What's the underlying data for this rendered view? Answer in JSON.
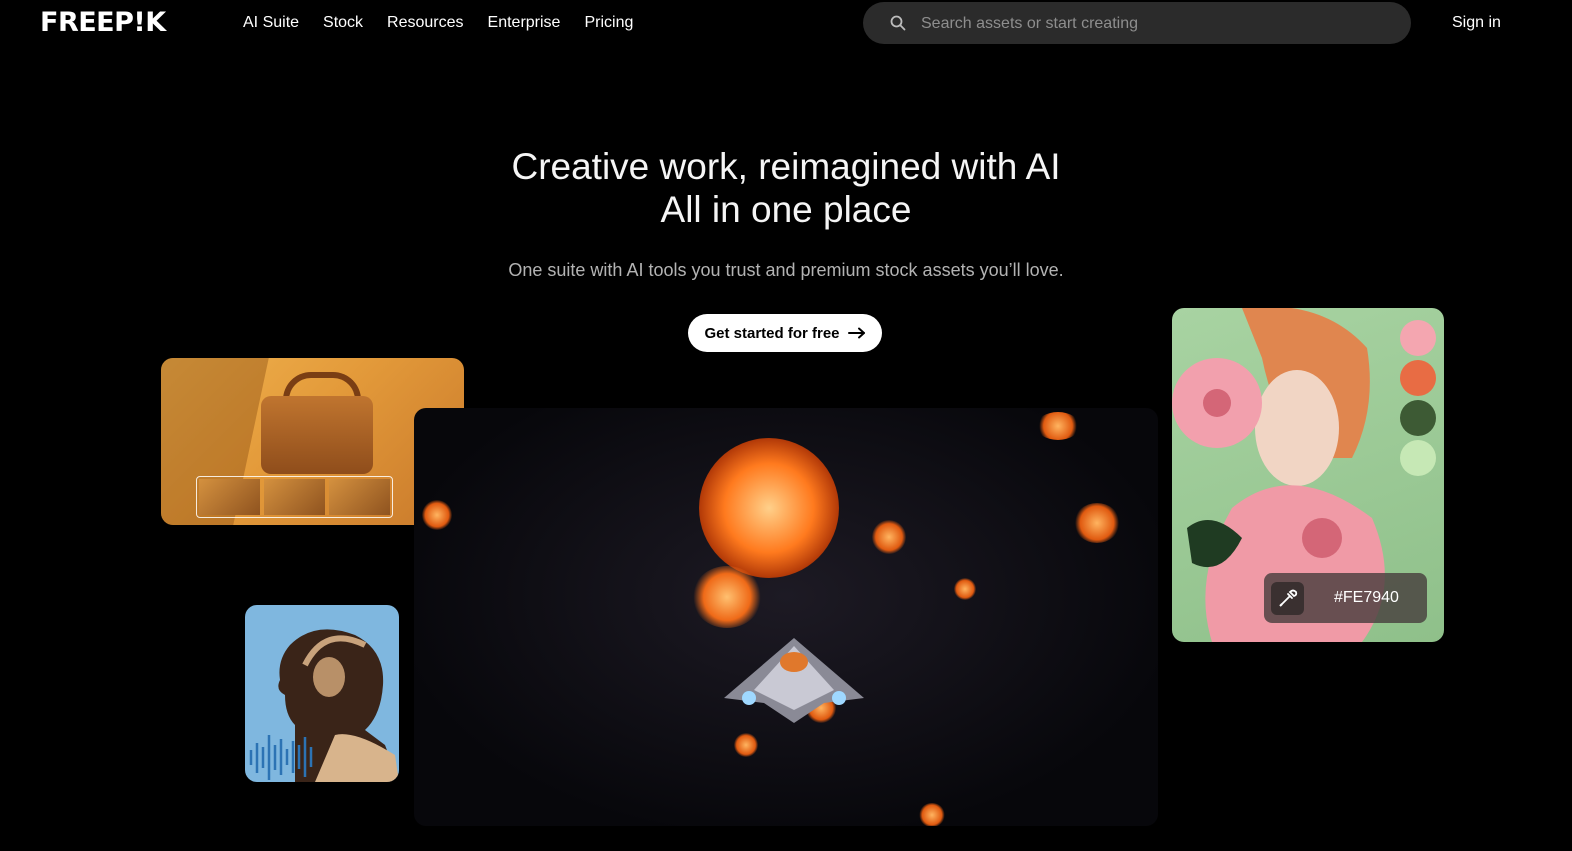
{
  "header": {
    "logo": "FREEP!K",
    "nav": [
      "AI Suite",
      "Stock",
      "Resources",
      "Enterprise",
      "Pricing"
    ],
    "search": {
      "placeholder": "Search assets or start creating",
      "value": ""
    },
    "signin_label": "Sign in"
  },
  "hero": {
    "title_line1": "Creative work, reimagined with AI",
    "title_line2": "All in one place",
    "subtitle": "One suite with AI tools you trust and premium stock assets you’ll love.",
    "cta_label": "Get started for free",
    "cta_icon": "arrow-right-icon"
  },
  "showcase": {
    "color_card": {
      "swatches": [
        "#F4A6B0",
        "#E86C44",
        "#3D5A34",
        "#C6E8B5"
      ],
      "picker_icon": "eyedropper-icon",
      "hex_label": "#FE7940"
    }
  },
  "colors": {
    "background": "#000000",
    "search_bg": "#2B2B2B",
    "cta_bg": "#FFFFFF"
  }
}
